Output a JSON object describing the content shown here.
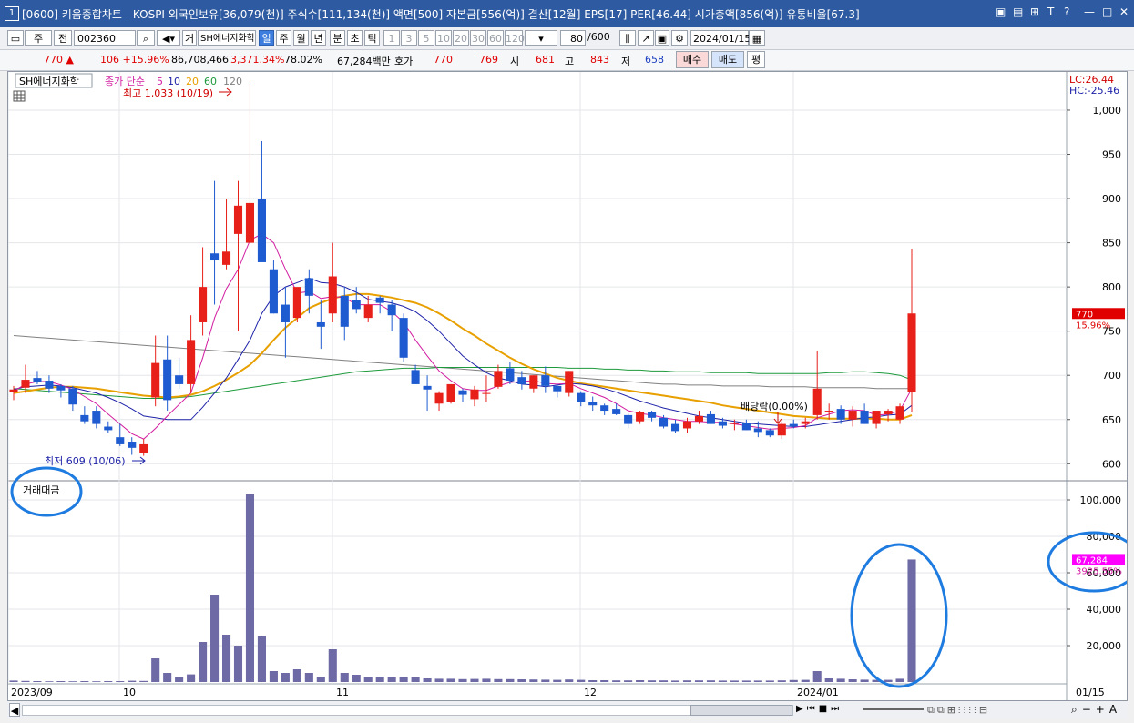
{
  "window": {
    "number": "1",
    "title": "[0600] 키움종합차트 - KOSPI 외국인보유[36,079(천)] 주식수[111,134(천)] 액면[500] 자본금[556(억)] 결산[12월] EPS[17] PER[46.44] 시가총액[856(억)] 유통비율[67.3]",
    "controls": [
      "▣",
      "▤",
      "⊞",
      "T",
      "?",
      "—",
      "□",
      "✕"
    ]
  },
  "toolbar": {
    "market": "주",
    "mode": "전",
    "code": "002360",
    "name_btn": "거",
    "name": "SH에너지화학",
    "periods": [
      "일",
      "주",
      "월",
      "년",
      "분",
      "초",
      "틱"
    ],
    "selected_period": "일",
    "minutes": [
      "1",
      "3",
      "5",
      "10",
      "20",
      "30",
      "60",
      "120"
    ],
    "count": "80",
    "count_total": "/600",
    "date": "2024/01/15"
  },
  "quote": {
    "price": "770 ▲",
    "change": "106 +15.96%",
    "volume": "86,708,466",
    "vol_ratio": "3,371.34%",
    "pct": "78.02%",
    "amount": "67,284백만",
    "bid_label": "호가",
    "ask": "770",
    "bid": "769",
    "open_label": "시",
    "open": "681",
    "high_label": "고",
    "high": "843",
    "low_label": "저",
    "low": "658",
    "buy": "매수",
    "sell": "매도",
    "avg": "평"
  },
  "chart_data": [
    {
      "type": "candlestick",
      "title": "SH에너지화학",
      "ma_legend": {
        "label": "종가 단순",
        "periods": [
          "5",
          "10",
          "20",
          "60",
          "120"
        ],
        "colors": [
          "#d21ca0",
          "#1e22a8",
          "#e8a000",
          "#1e9a3c",
          "#808080"
        ]
      },
      "ylim": [
        590,
        1035
      ],
      "y_ticks": [
        "600",
        "650",
        "700",
        "750",
        "800",
        "850",
        "900",
        "950",
        "1,000"
      ],
      "x_labels": [
        "2023/09",
        "10",
        "11",
        "12",
        "2024/01"
      ],
      "right_date": "01/15",
      "lc": "LC:26.44",
      "hc": "HC:-25.46",
      "last_price": "770",
      "last_change": "15.96%",
      "high_note": "최고 1,033 (10/19)",
      "low_note": "최저 609 (10/06)",
      "event_note": "배당락(0.00%)",
      "candles": [
        [
          681,
          688,
          672,
          684
        ],
        [
          686,
          712,
          680,
          695
        ],
        [
          697,
          705,
          690,
          693
        ],
        [
          694,
          700,
          680,
          685
        ],
        [
          688,
          690,
          675,
          683
        ],
        [
          685,
          688,
          660,
          667
        ],
        [
          655,
          665,
          645,
          648
        ],
        [
          660,
          665,
          640,
          645
        ],
        [
          642,
          648,
          635,
          638
        ],
        [
          630,
          645,
          620,
          622
        ],
        [
          625,
          630,
          610,
          618
        ],
        [
          612,
          628,
          609,
          622
        ],
        [
          675,
          745,
          665,
          714
        ],
        [
          718,
          745,
          660,
          672
        ],
        [
          700,
          720,
          685,
          690
        ],
        [
          690,
          768,
          680,
          740
        ],
        [
          760,
          845,
          745,
          800
        ],
        [
          838,
          920,
          780,
          830
        ],
        [
          825,
          900,
          820,
          840
        ],
        [
          860,
          920,
          750,
          892
        ],
        [
          850,
          1033,
          830,
          895
        ],
        [
          900,
          965,
          830,
          828
        ],
        [
          820,
          830,
          770,
          770
        ],
        [
          780,
          800,
          720,
          760
        ],
        [
          765,
          795,
          760,
          800
        ],
        [
          810,
          820,
          770,
          790
        ],
        [
          760,
          785,
          730,
          755
        ],
        [
          770,
          850,
          760,
          812
        ],
        [
          790,
          800,
          740,
          755
        ],
        [
          785,
          800,
          770,
          775
        ],
        [
          765,
          790,
          760,
          780
        ],
        [
          788,
          790,
          770,
          782
        ],
        [
          780,
          785,
          750,
          768
        ],
        [
          765,
          770,
          715,
          720
        ],
        [
          706,
          712,
          690,
          690
        ],
        [
          688,
          700,
          660,
          684
        ],
        [
          668,
          682,
          660,
          680
        ],
        [
          670,
          690,
          668,
          690
        ],
        [
          683,
          685,
          670,
          678
        ],
        [
          673,
          688,
          665,
          684
        ],
        [
          680,
          700,
          670,
          680
        ],
        [
          687,
          712,
          685,
          705
        ],
        [
          708,
          715,
          690,
          694
        ],
        [
          698,
          705,
          684,
          690
        ],
        [
          685,
          700,
          680,
          700
        ],
        [
          700,
          710,
          680,
          688
        ],
        [
          688,
          690,
          675,
          682
        ],
        [
          680,
          705,
          676,
          705
        ],
        [
          680,
          682,
          665,
          670
        ],
        [
          670,
          676,
          660,
          666
        ],
        [
          666,
          668,
          655,
          660
        ],
        [
          662,
          668,
          655,
          656
        ],
        [
          655,
          657,
          640,
          645
        ],
        [
          648,
          660,
          645,
          658
        ],
        [
          658,
          660,
          648,
          652
        ],
        [
          652,
          655,
          640,
          642
        ],
        [
          645,
          650,
          635,
          637
        ],
        [
          640,
          652,
          635,
          648
        ],
        [
          648,
          660,
          645,
          654
        ],
        [
          656,
          660,
          645,
          645
        ],
        [
          648,
          652,
          640,
          643
        ],
        [
          645,
          650,
          638,
          646
        ],
        [
          646,
          650,
          638,
          638
        ],
        [
          640,
          648,
          630,
          636
        ],
        [
          638,
          640,
          630,
          632
        ],
        [
          632,
          648,
          628,
          645
        ],
        [
          645,
          650,
          640,
          642
        ],
        [
          645,
          652,
          640,
          648
        ],
        [
          655,
          728,
          650,
          685
        ],
        [
          660,
          668,
          650,
          660
        ],
        [
          662,
          666,
          645,
          650
        ],
        [
          650,
          665,
          642,
          660
        ],
        [
          660,
          668,
          645,
          645
        ],
        [
          645,
          660,
          640,
          660
        ],
        [
          656,
          662,
          648,
          660
        ],
        [
          650,
          668,
          645,
          665
        ],
        [
          681,
          843,
          658,
          770
        ]
      ],
      "ma5": [
        682,
        690,
        693,
        693,
        689,
        684,
        676,
        668,
        656,
        645,
        634,
        628,
        640,
        654,
        667,
        680,
        720,
        765,
        798,
        820,
        853,
        860,
        850,
        820,
        793,
        795,
        787,
        789,
        788,
        780,
        780,
        780,
        772,
        760,
        740,
        722,
        705,
        694,
        685,
        683,
        683,
        688,
        692,
        693,
        694,
        691,
        690,
        691,
        685,
        680,
        675,
        668,
        660,
        657,
        655,
        652,
        650,
        648,
        648,
        647,
        647,
        645,
        643,
        641,
        639,
        640,
        641,
        643,
        652,
        656,
        660,
        661,
        660,
        655,
        656,
        660,
        685
      ],
      "ma10": [
        684,
        687,
        688,
        689,
        688,
        686,
        683,
        680,
        675,
        669,
        662,
        654,
        652,
        650,
        650,
        650,
        664,
        680,
        697,
        718,
        740,
        770,
        790,
        800,
        805,
        810,
        805,
        804,
        800,
        794,
        786,
        784,
        782,
        778,
        772,
        762,
        750,
        736,
        722,
        712,
        703,
        697,
        694,
        690,
        689,
        687,
        689,
        691,
        690,
        688,
        685,
        681,
        676,
        671,
        667,
        663,
        660,
        657,
        654,
        652,
        650,
        648,
        646,
        645,
        644,
        643,
        642,
        642,
        644,
        646,
        648,
        650,
        652,
        653,
        655,
        656,
        666
      ],
      "ma20": [
        680,
        682,
        684,
        686,
        687,
        687,
        686,
        685,
        683,
        681,
        679,
        677,
        676,
        675,
        676,
        678,
        682,
        688,
        695,
        703,
        712,
        725,
        740,
        754,
        765,
        776,
        782,
        787,
        790,
        792,
        792,
        790,
        788,
        785,
        782,
        777,
        770,
        762,
        753,
        745,
        736,
        728,
        720,
        713,
        707,
        702,
        697,
        694,
        691,
        689,
        687,
        685,
        683,
        681,
        679,
        677,
        675,
        673,
        671,
        669,
        666,
        664,
        662,
        660,
        658,
        656,
        654,
        653,
        652,
        651,
        651,
        651,
        651,
        651,
        650,
        650,
        655
      ],
      "ma60": [
        685,
        684,
        683,
        682,
        681,
        680,
        679,
        678,
        677,
        676,
        675,
        674,
        674,
        674,
        675,
        676,
        678,
        680,
        682,
        684,
        686,
        688,
        690,
        692,
        694,
        696,
        698,
        700,
        702,
        704,
        705,
        706,
        707,
        708,
        708,
        708,
        709,
        709,
        709,
        709,
        709,
        709,
        709,
        709,
        709,
        709,
        709,
        708,
        708,
        708,
        707,
        707,
        706,
        706,
        705,
        705,
        704,
        704,
        704,
        703,
        703,
        703,
        703,
        702,
        702,
        702,
        702,
        702,
        702,
        703,
        703,
        704,
        704,
        703,
        702,
        700,
        695
      ],
      "ma120": [
        745,
        744,
        743,
        742,
        741,
        740,
        739,
        738,
        737,
        736,
        735,
        734,
        733,
        732,
        731,
        730,
        729,
        728,
        727,
        726,
        725,
        724,
        723,
        722,
        721,
        720,
        719,
        718,
        717,
        716,
        715,
        714,
        713,
        712,
        711,
        710,
        709,
        708,
        707,
        706,
        705,
        704,
        703,
        702,
        701,
        700,
        699,
        698,
        697,
        696,
        695,
        694,
        693,
        692,
        691,
        690,
        690,
        689,
        689,
        689,
        688,
        688,
        688,
        688,
        687,
        687,
        687,
        687,
        686,
        686,
        686,
        686,
        686,
        685,
        685,
        685,
        685
      ]
    },
    {
      "type": "bar",
      "title": "거래대금",
      "ylim": [
        0,
        110000
      ],
      "y_ticks": [
        "20,000",
        "40,000",
        "60,000",
        "80,000",
        "100,000"
      ],
      "last_value": "67,284",
      "last_change": "3925.55%",
      "values": [
        800,
        600,
        500,
        400,
        500,
        400,
        500,
        400,
        500,
        500,
        700,
        600,
        13000,
        5000,
        2500,
        4200,
        22000,
        48000,
        26000,
        20000,
        103000,
        25000,
        6000,
        5000,
        7000,
        5000,
        3000,
        18000,
        5000,
        4000,
        2500,
        3000,
        2500,
        2800,
        2500,
        2000,
        1800,
        1800,
        1600,
        1700,
        1800,
        1600,
        1600,
        1500,
        1400,
        1300,
        1200,
        1400,
        1200,
        1000,
        1000,
        900,
        900,
        1000,
        900,
        900,
        800,
        900,
        900,
        900,
        800,
        800,
        800,
        800,
        800,
        900,
        1100,
        1200,
        6000,
        2000,
        1800,
        1500,
        1300,
        1200,
        1200,
        1800,
        67284
      ]
    }
  ]
}
